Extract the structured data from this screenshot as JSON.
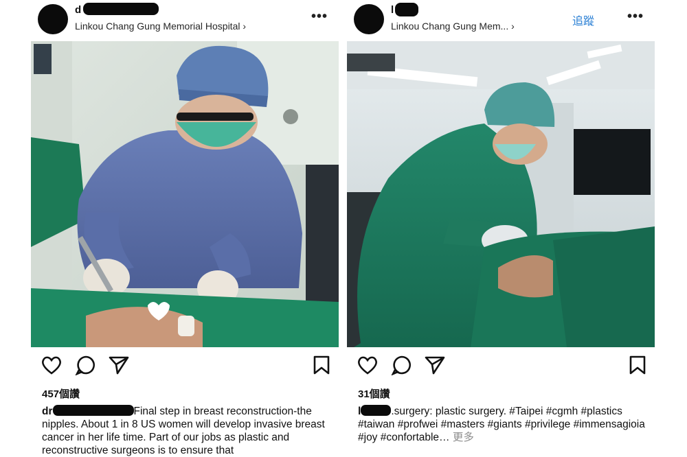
{
  "posts": [
    {
      "username_visible": "d",
      "location": "Linkou Chang Gung Memorial Hospital ›",
      "likes": "457個讚",
      "caption_prefix": "dr",
      "caption_text": "Final step in breast reconstruction-the nipples. About 1 in 8 US women will develop invasive breast cancer in her life time. Part of our jobs as plastic and reconstructive surgeons is to ensure that",
      "icons": [
        "heart-icon",
        "comment-icon",
        "send-icon",
        "bookmark-icon",
        "more-icon"
      ]
    },
    {
      "username_visible": "l",
      "location": "Linkou Chang Gung Mem... ›",
      "follow_label": "追蹤",
      "likes": "31個讚",
      "caption_prefix": "l",
      "caption_text": ".surgery: plastic surgery. #Taipei #cgmh #plastics #taiwan #profwei #masters #giants #privilege #immensagioia #joy #confortable…",
      "more_label": "更多",
      "icons": [
        "heart-icon",
        "comment-icon",
        "send-icon",
        "bookmark-icon",
        "more-icon"
      ]
    }
  ],
  "colors": {
    "link_blue": "#2a7fd4",
    "scrub_blue": "#5b6fa8",
    "scrub_green": "#1f7a5c",
    "drape_green": "#1e8a63"
  }
}
